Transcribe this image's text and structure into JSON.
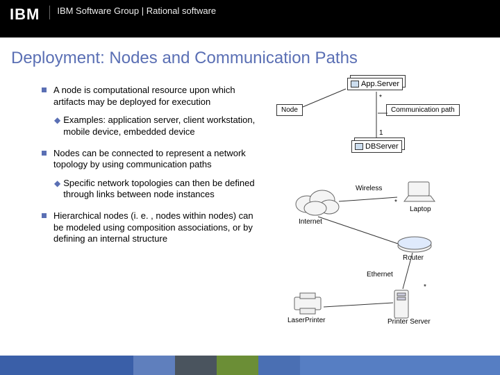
{
  "header": {
    "logo_text": "IBM",
    "title": "IBM Software Group | Rational software"
  },
  "slide_title": "Deployment: Nodes and Communication Paths",
  "bullets": {
    "b1": "A node is computational resource upon which artifacts may be deployed for execution",
    "b1a": "Examples: application server, client workstation, mobile device, embedded device",
    "b2": "Nodes can be connected to represent a network topology by using communication paths",
    "b2a": "Specific network topologies can then be defined through links between node instances",
    "b3": "Hierarchical nodes (i. e. , nodes within nodes) can be modeled using composition associations, or by defining an internal structure"
  },
  "diagram1": {
    "appserver": "App.Server",
    "dbserver": "DBServer",
    "node_label": "Node",
    "comm_label": "Communication path",
    "mult_star": "*",
    "mult_one": "1"
  },
  "diagram2": {
    "internet": "Internet",
    "wireless": "Wireless",
    "laptop": "Laptop",
    "router": "Router",
    "ethernet": "Ethernet",
    "printer_server": "Printer Server",
    "laser_printer": "LaserPrinter",
    "star": "*"
  }
}
